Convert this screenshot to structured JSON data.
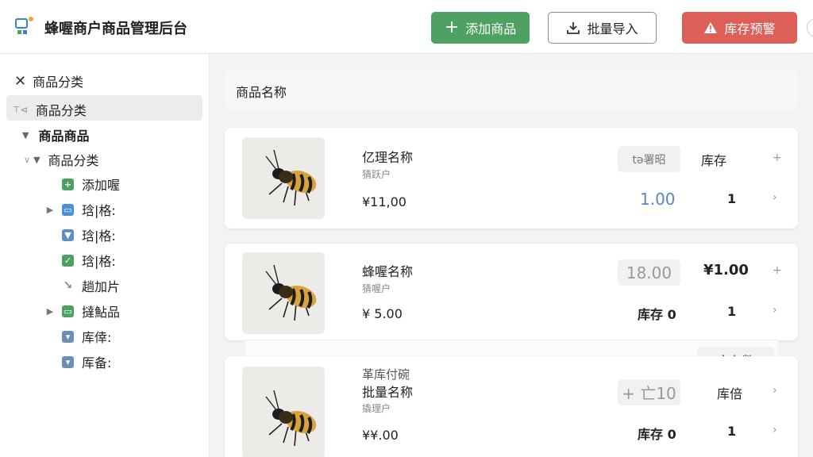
{
  "header": {
    "title": "蜂喔商户商品管理后台",
    "add_label": "添加商品",
    "import_label": "批量导入",
    "warn_label": "库存预警"
  },
  "sidebar": {
    "close_label": "商品分类",
    "active_label": "商品分类",
    "group_label": "商品商品",
    "sub_group_label": "商品分类",
    "items": [
      {
        "label": "添加喔",
        "icon": "plus-icon",
        "color": "#4ea162",
        "caret": false
      },
      {
        "label": "琀|格:",
        "icon": "table-icon",
        "color": "#4a90d9",
        "caret": true
      },
      {
        "label": "琀|格:",
        "icon": "filter-icon",
        "color": "#5b8fc4",
        "caret": false
      },
      {
        "label": "琀|格:",
        "icon": "check-icon",
        "color": "#4ea162",
        "caret": false
      },
      {
        "label": "趟加片",
        "icon": "arrow-icon",
        "color": "#888888",
        "caret": false
      },
      {
        "label": "撻鮎品",
        "icon": "table-icon",
        "color": "#4ea162",
        "caret": true
      },
      {
        "label": "库倖:",
        "icon": "box-icon",
        "color": "#6a8fb5",
        "caret": false
      },
      {
        "label": "厍备:",
        "icon": "funnel-icon",
        "color": "#6a8fb5",
        "caret": false
      }
    ]
  },
  "main": {
    "search_label": "商品名称",
    "floating_label": "库存数",
    "cards": [
      {
        "name": "亿理名称",
        "sub": "猜跃户",
        "price": "¥11,00",
        "pill": "tǝ署昭",
        "col1_top": "库存",
        "col1_bottom": "1.00",
        "col2_bottom": "1"
      },
      {
        "name": "蜂喔名称",
        "sub": "猜喔户",
        "price": "¥ 5.00",
        "pill": "18.00",
        "col1_top": "",
        "col2_top": "¥1.00",
        "col1_bottom": "库存 0",
        "col2_bottom": "1"
      },
      {
        "overlay": "革库付碗",
        "name": "批量名称",
        "sub": "撬理户",
        "price": "¥¥.00",
        "pill": "+ 亡10",
        "col2_top": "库倍",
        "col1_bottom": "库存 0",
        "col2_bottom": "1"
      }
    ]
  },
  "colors": {
    "primary_green": "#4ea162",
    "warn_red": "#de5f58",
    "accent_blue": "#5b86c5"
  }
}
